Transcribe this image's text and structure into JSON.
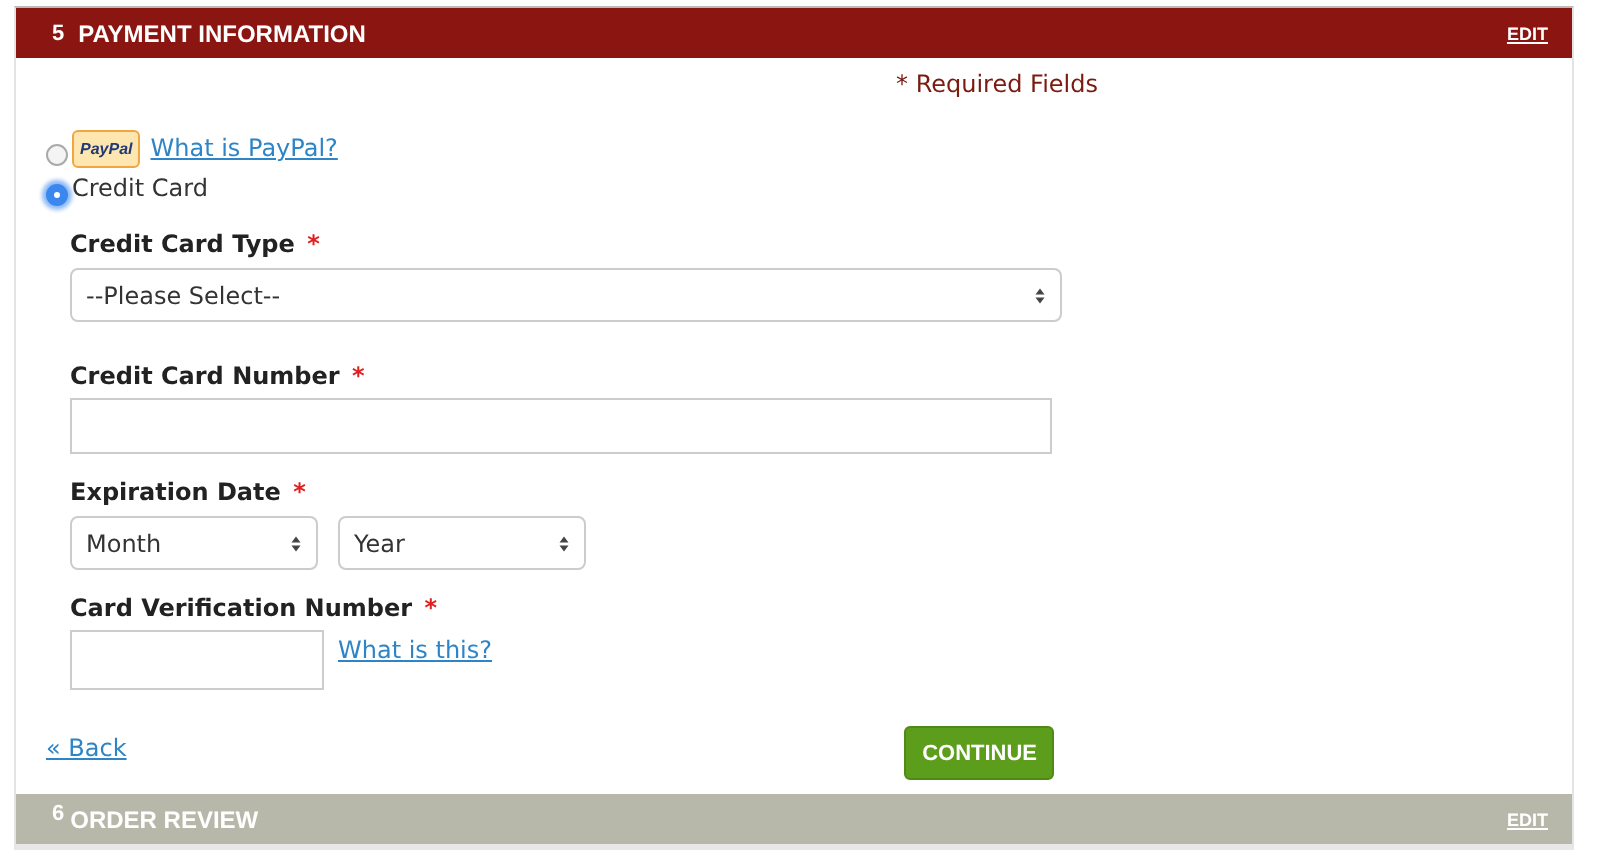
{
  "payment_section": {
    "number": "5",
    "title": "PAYMENT INFORMATION",
    "edit": "EDIT"
  },
  "required_note": "* Required Fields",
  "payment_methods": [
    {
      "kind": "paypal",
      "logo_text": "PayPal",
      "link": "What is PayPal?",
      "selected": false
    },
    {
      "kind": "card",
      "label": "Credit Card",
      "selected": true
    }
  ],
  "card_type": {
    "label": "Credit Card Type",
    "required_mark": "*",
    "value": "--Please Select--"
  },
  "card_number": {
    "label": "Credit Card Number",
    "required_mark": "*"
  },
  "expiration": {
    "label": "Expiration Date",
    "required_mark": "*",
    "month": "Month",
    "year": "Year"
  },
  "verification": {
    "label": "Card Verification Number",
    "required_mark": "*",
    "link": "What is this?"
  },
  "back_link": "« Back",
  "continue_button": "CONTINUE",
  "next_section": {
    "number": "6",
    "title": "ORDER REVIEW",
    "edit": "EDIT"
  }
}
